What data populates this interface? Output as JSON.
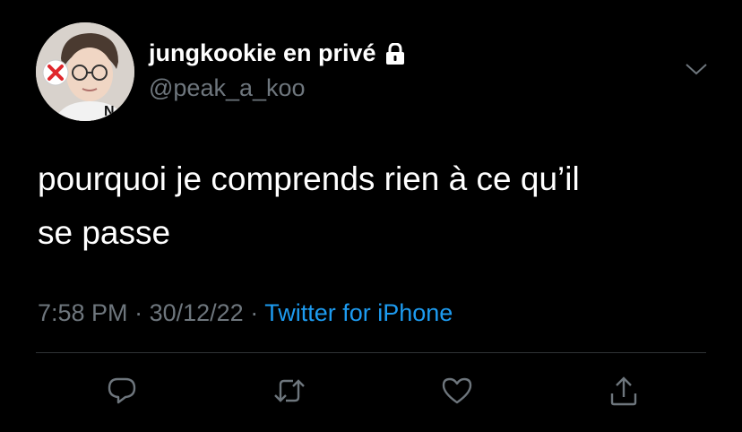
{
  "author": {
    "display_name": "jungkookie en privé",
    "handle": "@peak_a_koo",
    "avatar_icon": "user-avatar",
    "protected_icon": "lock-icon"
  },
  "tweet": {
    "text_lines": [
      "pourquoi je comprends rien à ce qu’il",
      "se passe"
    ]
  },
  "meta": {
    "time": "7:58 PM",
    "separator": "·",
    "date": "30/12/22",
    "source": "Twitter for iPhone"
  },
  "actions": [
    {
      "icon": "reply-icon"
    },
    {
      "icon": "retweet-icon"
    },
    {
      "icon": "like-icon"
    },
    {
      "icon": "share-icon"
    }
  ],
  "colors": {
    "background": "#000000",
    "text": "#ffffff",
    "muted": "#6e767d",
    "link": "#1d9bf0",
    "divider": "#2f3336"
  }
}
